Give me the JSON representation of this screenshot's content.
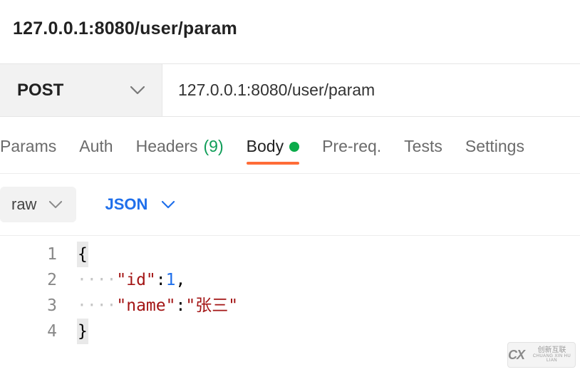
{
  "title": "127.0.0.1:8080/user/param",
  "request": {
    "method": "POST",
    "url": "127.0.0.1:8080/user/param"
  },
  "tabs": {
    "params": "Params",
    "auth": "Auth",
    "headers_label": "Headers",
    "headers_count": "(9)",
    "body": "Body",
    "prereq": "Pre-req.",
    "tests": "Tests",
    "settings": "Settings"
  },
  "body_options": {
    "mode": "raw",
    "format": "JSON"
  },
  "editor": {
    "line_numbers": [
      "1",
      "2",
      "3",
      "4"
    ],
    "lines": {
      "l1_brace": "{",
      "l2_key": "\"id\"",
      "l2_colon": ":",
      "l2_val": "1",
      "l2_comma": ",",
      "l3_key": "\"name\"",
      "l3_colon": ":",
      "l3_q1": "\"",
      "l3_val": "张三",
      "l3_q2": "\"",
      "l4_brace": "}"
    }
  },
  "watermark": {
    "brand": "创新互联",
    "sub": "CHUANG XIN HU LIAN"
  }
}
